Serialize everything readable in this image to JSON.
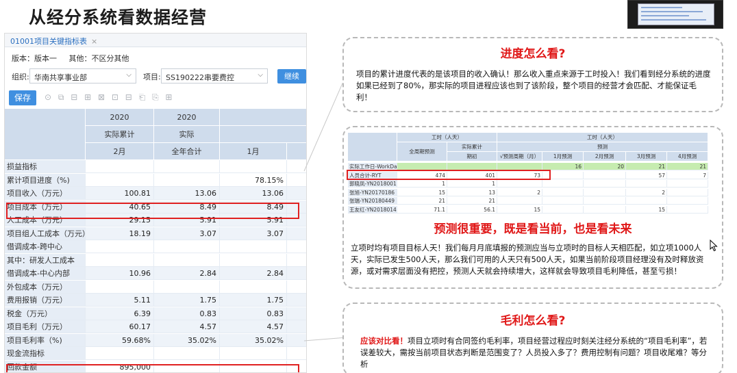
{
  "slide": {
    "title": "从经分系统看数据经营"
  },
  "app": {
    "tab_label": "01001项目关键指标表",
    "tab_close": "×",
    "version": "版本：版本一",
    "other": "其他：不区分其他",
    "org_label": "组织:",
    "org_value": "华南共享事业部",
    "project_label": "项目:",
    "project_value": "SS190222串要费控",
    "continue_label": "继续",
    "save_label": "保存",
    "toolbar_icons": "⊙ ⧉ ⊟ ⊞ ⊠ ⊡ ⊟ ⎗ ⎘ ⊞"
  },
  "table": {
    "year_row": [
      "2020",
      "2020",
      ""
    ],
    "type_row": [
      "实际累计",
      "实际",
      ""
    ],
    "period_row": [
      "2月",
      "全年合计",
      "1月"
    ],
    "rows": [
      {
        "label": "损益指标",
        "c1": "",
        "c2": "",
        "c3": ""
      },
      {
        "label": "累计项目进度（%)",
        "c1": "",
        "c2": "",
        "c3": "78.15%"
      },
      {
        "label": "项目收入（万元）",
        "c1": "100.81",
        "c2": "13.06",
        "c3": "13.06"
      },
      {
        "label": "项目成本（万元）",
        "c1": "40.65",
        "c2": "8.49",
        "c3": "8.49"
      },
      {
        "label": "人工成本（万元）",
        "c1": "29.15",
        "c2": "5.91",
        "c3": "5.91"
      },
      {
        "label": "项目组人工成本（万元）",
        "c1": "18.19",
        "c2": "3.07",
        "c3": "3.07"
      },
      {
        "label": "借调成本-跨中心",
        "c1": "",
        "c2": "",
        "c3": ""
      },
      {
        "label": "其中：研发人工成本",
        "c1": "",
        "c2": "",
        "c3": ""
      },
      {
        "label": "借调成本-中心内部",
        "c1": "10.96",
        "c2": "2.84",
        "c3": "2.84"
      },
      {
        "label": "外包成本（万元）",
        "c1": "",
        "c2": "",
        "c3": ""
      },
      {
        "label": "费用报销（万元）",
        "c1": "5.11",
        "c2": "1.75",
        "c3": "1.75"
      },
      {
        "label": "税金（万元）",
        "c1": "6.39",
        "c2": "0.83",
        "c3": "0.83"
      },
      {
        "label": "项目毛利（万元）",
        "c1": "60.17",
        "c2": "4.57",
        "c3": "4.57"
      },
      {
        "label": "项目毛利率（%)",
        "c1": "59.68%",
        "c2": "35.02%",
        "c3": "35.02%"
      },
      {
        "label": "现金流指标",
        "c1": "",
        "c2": "",
        "c3": ""
      },
      {
        "label": "回款金额",
        "c1": "895,000",
        "c2": "",
        "c3": ""
      }
    ]
  },
  "panels": {
    "progress": {
      "title": "进度怎么看?",
      "text": "项目的累计进度代表的是该项目的收入确认！那么收入重点来源于工时投入！我们看到经分系统的进度如果已经到了80%，那实际的项目进程应该也到了该阶段，整个项目的经营才会匹配、才能保证毛利！"
    },
    "forecast": {
      "title": "预测很重要，既是看当前，也是看未来",
      "text": "立项时均有项目目标人天！我们每月月底填报的预测应当与立项时的目标人天相匹配，如立项1000人天，实际已发生500人天，那么我们可用的人天只有500人天，如果当前阶段项目经理没有及时释放资源，或对需求层面没有把控，预测人天就会持续增大，这样就会导致项目毛利降低，甚至亏损！"
    },
    "margin": {
      "title": "毛利怎么看?",
      "lead": "应该对比看！",
      "text": "项目立项时有合同签约毛利率，项目经营过程应时刻关注经分系统的“项目毛利率”，若误差较大，需按当前项目状态判断是范围变了？人员投入多了？费用控制有问题？项目收尾难？等分析"
    }
  },
  "mini": {
    "h1": [
      "工时（人天）",
      "工时（人天）"
    ],
    "h2": [
      "全周期预测",
      "实际累计",
      "预测"
    ],
    "h3": [
      "期初",
      "√预测周期（月）",
      "1月预测",
      "2月预测",
      "3月预测",
      "4月预测"
    ],
    "rows": [
      {
        "label": "实际工作日-WorkDay",
        "v": [
          "",
          "",
          "",
          "16",
          "20",
          "21",
          "21"
        ]
      },
      {
        "label": "人员合计-RYT",
        "v": [
          "474",
          "401",
          "73",
          "",
          "",
          "57",
          "7"
        ]
      },
      {
        "label": "郭晓凤-YN20180011",
        "v": [
          "1",
          "1",
          "",
          "",
          "",
          "",
          ""
        ]
      },
      {
        "label": "张旭-YN20170186",
        "v": [
          "15",
          "13",
          "2",
          "",
          "",
          "2",
          ""
        ]
      },
      {
        "label": "张瑞-YN20180449",
        "v": [
          "21",
          "21",
          "",
          "",
          "",
          "",
          ""
        ]
      },
      {
        "label": "王友红-YN20180145",
        "v": [
          "71.1",
          "56.1",
          "15",
          "",
          "",
          "15",
          ""
        ]
      }
    ]
  }
}
